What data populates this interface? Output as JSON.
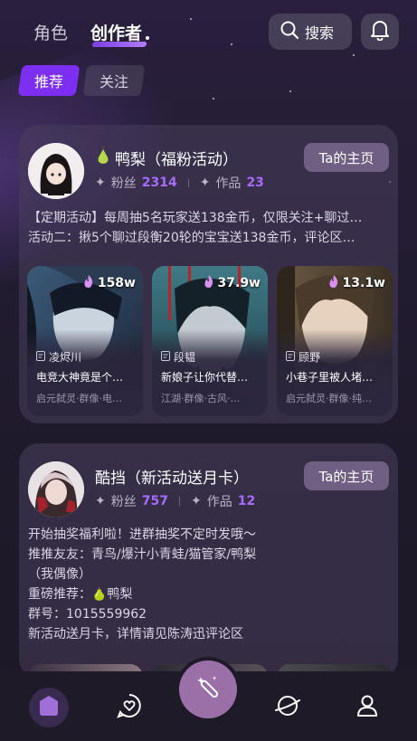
{
  "top_tabs": {
    "role": "角色",
    "creator": "创作者"
  },
  "search": {
    "label": "搜索"
  },
  "filters": {
    "recommend": "推荐",
    "follow": "关注"
  },
  "cards": [
    {
      "name": "鸭梨（福粉活动）",
      "fans_label": "粉丝",
      "fans": "2314",
      "works_label": "作品",
      "works": "23",
      "home_label": "Ta的主页",
      "desc": [
        "【定期活动】每周抽5名玩家送138金币，仅限关注+聊过…",
        "活动二：揪5个聊过段衡20轮的宝宝送138金币，评论区…"
      ],
      "items": [
        {
          "heat": "158w",
          "author": "凌烬川",
          "title": "电竞大神竟是个…",
          "tags": "启元弑灵·群像·电…"
        },
        {
          "heat": "37.9w",
          "author": "段韫",
          "title": "新娘子让你代替…",
          "tags": "江湖·群像·古风·…"
        },
        {
          "heat": "13.1w",
          "author": "顾野",
          "title": "小巷子里被人堵…",
          "tags": "启元弑灵·群像·纯…"
        }
      ]
    },
    {
      "name": "酷挡（新活动送月卡）",
      "fans_label": "粉丝",
      "fans": "757",
      "works_label": "作品",
      "works": "12",
      "home_label": "Ta的主页",
      "desc": [
        "开始抽奖福利啦！进群抽奖不定时发哦～",
        "推推友友：青鸟/爆汁小青蛙/猫管家/鸭梨",
        "（我偶像）",
        "重磅推荐：🍐鸭梨",
        "群号：1015559962",
        "新活动送月卡，详情请见陈涛迅评论区"
      ]
    }
  ],
  "colors": {
    "accent": "#7c2ff0",
    "stat_number": "#a66cff",
    "fab": "#9b6fa8"
  }
}
